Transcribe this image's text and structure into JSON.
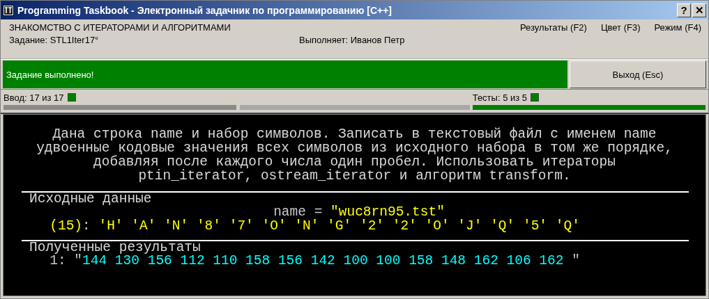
{
  "window": {
    "title": "Programming Taskbook - Электронный задачник по программированию [C++]",
    "buttons": [
      "?",
      "✕"
    ]
  },
  "header": {
    "topic": "ЗНАКОМСТВО С ИТЕРАТОРАМИ И АЛГОРИТМАМИ",
    "task": "Задание: STL1Iter17°",
    "student": "Выполняет: Иванов Петр",
    "menu": [
      "Результаты (F2)",
      "Цвет (F3)",
      "Режим (F4)"
    ]
  },
  "status": {
    "message": "Задание выполнено!",
    "success": true,
    "exit_button": "Выход (Esc)"
  },
  "progress": [
    {
      "label": "Ввод: 17 из 17",
      "done": true,
      "level": 0.5
    },
    {
      "label": "Тесты: 5 из 5",
      "done": true,
      "level": 1
    }
  ],
  "description": [
    "Дана строка name и набор символов. Записать в текстовый файл с именем name",
    "удвоенные кодовые значения всех символов из исходного набора в том же порядке,",
    "добавляя после каждого числа один пробел. Использовать итераторы",
    "ptin_iterator, ostream_iterator и алгоритм transform."
  ],
  "sections": [
    {
      "title": "Исходные данные",
      "lines": [
        {
          "centered": true,
          "segments": [
            {
              "kind": "label",
              "text": "name = "
            },
            {
              "kind": "input",
              "text": "\"wuc8rn95.tst\""
            }
          ]
        },
        {
          "centered": false,
          "segments": [
            {
              "kind": "input",
              "text": "(15)"
            },
            {
              "kind": "label",
              "text": ": "
            },
            {
              "kind": "input",
              "text": "'H' 'A' 'N' '8' '7' 'O' 'N' 'G' '2' '2' 'O' 'J' 'Q' '5' 'Q'"
            }
          ]
        }
      ]
    },
    {
      "title": "Полученные результаты",
      "lines": [
        {
          "centered": false,
          "segments": [
            {
              "kind": "label",
              "text": "1: \""
            },
            {
              "kind": "output",
              "text": "144 130 156 112 110 158 156 142 100 100 158 148 162 106 162"
            },
            {
              "kind": "label",
              "text": " \""
            }
          ]
        }
      ]
    }
  ]
}
